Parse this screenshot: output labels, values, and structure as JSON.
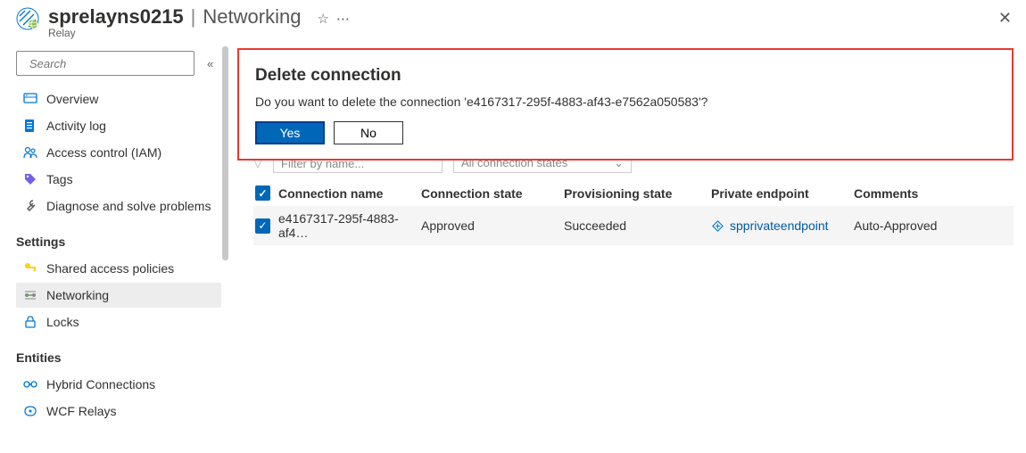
{
  "header": {
    "title": "sprelayns0215",
    "page": "Networking",
    "subtitle": "Relay"
  },
  "sidebar": {
    "search_placeholder": "Search",
    "items_top": [
      {
        "label": "Overview",
        "icon": "overview"
      },
      {
        "label": "Activity log",
        "icon": "activity"
      },
      {
        "label": "Access control (IAM)",
        "icon": "access"
      },
      {
        "label": "Tags",
        "icon": "tag"
      },
      {
        "label": "Diagnose and solve problems",
        "icon": "wrench"
      }
    ],
    "group_settings": "Settings",
    "items_settings": [
      {
        "label": "Shared access policies",
        "icon": "key"
      },
      {
        "label": "Networking",
        "icon": "networking",
        "active": true
      },
      {
        "label": "Locks",
        "icon": "lock"
      }
    ],
    "group_entities": "Entities",
    "items_entities": [
      {
        "label": "Hybrid Connections",
        "icon": "hybrid"
      },
      {
        "label": "WCF Relays",
        "icon": "wcf"
      }
    ]
  },
  "dialog": {
    "title": "Delete connection",
    "message": "Do you want to delete the connection 'e4167317-295f-4883-af43-e7562a050583'?",
    "yes": "Yes",
    "no": "No"
  },
  "filters": {
    "name_placeholder": "Filter by name...",
    "state_placeholder": "All connection states"
  },
  "table": {
    "headers": {
      "conn": "Connection name",
      "cstate": "Connection state",
      "pstate": "Provisioning state",
      "pe": "Private endpoint",
      "comments": "Comments"
    },
    "rows": [
      {
        "conn": "e4167317-295f-4883-af4…",
        "cstate": "Approved",
        "pstate": "Succeeded",
        "pe": "spprivateendpoint",
        "comments": "Auto-Approved"
      }
    ]
  }
}
